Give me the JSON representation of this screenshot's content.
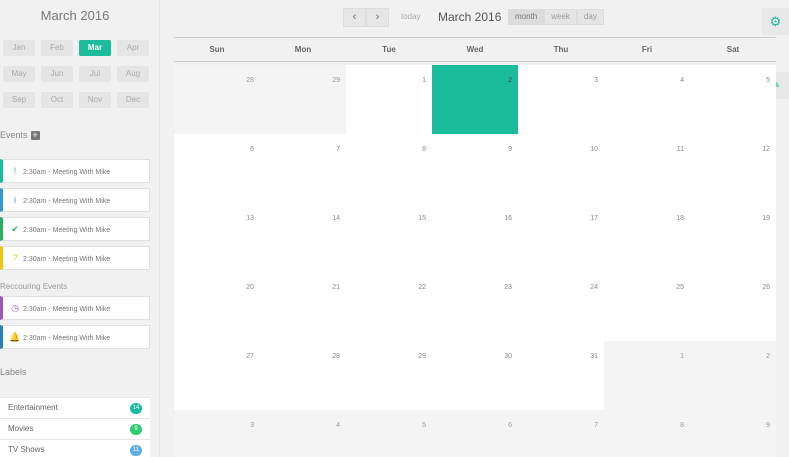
{
  "sidebar": {
    "title": "March 2016",
    "months": [
      "Jan",
      "Feb",
      "Mar",
      "Apr",
      "May",
      "Jun",
      "Jul",
      "Aug",
      "Sep",
      "Oct",
      "Nov",
      "Dec"
    ],
    "active_month": "Mar",
    "events_title": "Events",
    "events": [
      {
        "icon": "exclamation-icon",
        "glyph": "!",
        "text": "2:30am - Meeting With Mike",
        "color": "#1abc9c"
      },
      {
        "icon": "info-icon",
        "glyph": "i",
        "text": "2:30am - Meeting With Mike",
        "color": "#3498db"
      },
      {
        "icon": "check-icon",
        "glyph": "✔",
        "text": "2:30am - Meeting With Mike",
        "color": "#27ae60"
      },
      {
        "icon": "question-icon",
        "glyph": "?",
        "text": "2:30am - Meeting With Mike",
        "color": "#f1c40f"
      }
    ],
    "recurring_title": "Reccouring Events",
    "recurring": [
      {
        "icon": "clock-icon",
        "glyph": "◷",
        "text": "2:30am - Meeting With Mike",
        "color": "#9b59b6"
      },
      {
        "icon": "bell-icon",
        "glyph": "🔔",
        "text": "2:30am - Meeting With Mike",
        "color": "#2980b9"
      }
    ],
    "labels_title": "Labels",
    "labels": [
      {
        "name": "Entertainment",
        "count": "14",
        "color": "#1abc9c"
      },
      {
        "name": "Movies",
        "count": "9",
        "color": "#2ecc71"
      },
      {
        "name": "TV Shows",
        "count": "11",
        "color": "#5dade2"
      }
    ]
  },
  "toolbar": {
    "prev": "‹",
    "next": "›",
    "today": "today",
    "title": "March 2016",
    "views": [
      {
        "label": "month",
        "active": true
      },
      {
        "label": "week",
        "active": false
      },
      {
        "label": "day",
        "active": false
      }
    ]
  },
  "calendar": {
    "days_of_week": [
      "Sun",
      "Mon",
      "Tue",
      "Wed",
      "Thu",
      "Fri",
      "Sat"
    ],
    "accent_color": "#1abc9c",
    "weeks": [
      [
        {
          "n": "28",
          "other": true
        },
        {
          "n": "29",
          "other": true
        },
        {
          "n": "1"
        },
        {
          "n": "2",
          "today": true
        },
        {
          "n": "3"
        },
        {
          "n": "4"
        },
        {
          "n": "5"
        }
      ],
      [
        {
          "n": "6"
        },
        {
          "n": "7"
        },
        {
          "n": "8"
        },
        {
          "n": "9"
        },
        {
          "n": "10"
        },
        {
          "n": "11"
        },
        {
          "n": "12"
        }
      ],
      [
        {
          "n": "13"
        },
        {
          "n": "14"
        },
        {
          "n": "15"
        },
        {
          "n": "16"
        },
        {
          "n": "17"
        },
        {
          "n": "18"
        },
        {
          "n": "19"
        }
      ],
      [
        {
          "n": "20"
        },
        {
          "n": "21"
        },
        {
          "n": "22"
        },
        {
          "n": "23"
        },
        {
          "n": "24"
        },
        {
          "n": "25"
        },
        {
          "n": "26"
        }
      ],
      [
        {
          "n": "27"
        },
        {
          "n": "28"
        },
        {
          "n": "29"
        },
        {
          "n": "30"
        },
        {
          "n": "31"
        },
        {
          "n": "1",
          "other": true
        },
        {
          "n": "2",
          "other": true
        }
      ],
      [
        {
          "n": "3",
          "other": true
        },
        {
          "n": "4",
          "other": true
        },
        {
          "n": "5",
          "other": true
        },
        {
          "n": "6",
          "other": true
        },
        {
          "n": "7",
          "other": true
        },
        {
          "n": "8",
          "other": true
        },
        {
          "n": "9",
          "other": true
        }
      ]
    ]
  },
  "tools": {
    "gear_icon": "gear-icon",
    "pencil_icon": "pencil-icon"
  }
}
